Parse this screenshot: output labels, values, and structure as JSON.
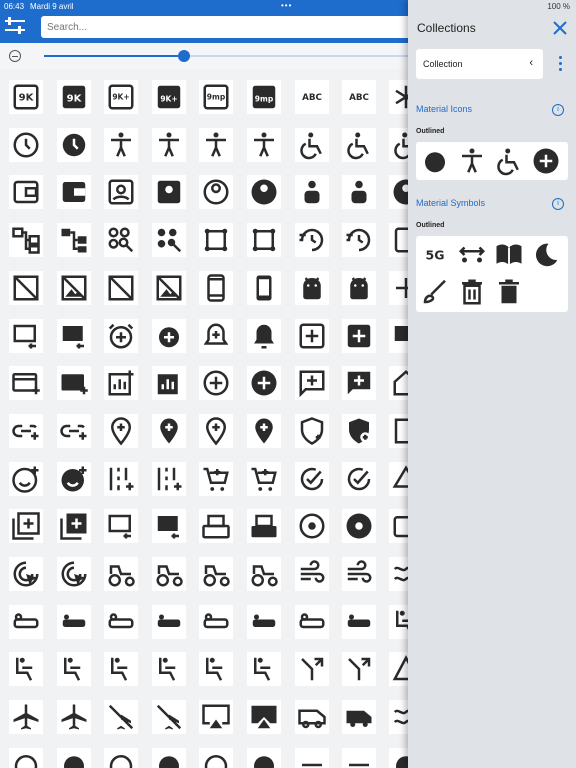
{
  "status": {
    "time": "06:43",
    "date": "Mardi 9 avril",
    "dots": "•••",
    "battery": "100 %"
  },
  "search": {
    "placeholder": "Search..."
  },
  "panel": {
    "title": "Collections",
    "collection_label": "Collection",
    "sections": [
      {
        "title": "Material Icons",
        "subtitle": "Outlined",
        "icons": [
          "alarm-icon",
          "accessibility-icon",
          "accessible-forward-icon",
          "add-circle-icon"
        ]
      },
      {
        "title": "Material Symbols",
        "subtitle": "Outlined",
        "icons": [
          "5g-icon",
          "social-distance-icon",
          "menu-book-icon",
          "dark-mode-icon",
          "brush-icon",
          "delete-outline-icon",
          "delete-icon"
        ]
      }
    ]
  },
  "grid_icons": [
    [
      "9k-outline-icon",
      "9k-icon",
      "9k-plus-outline-icon",
      "9k-plus-icon",
      "9mp-outline-icon",
      "9mp-icon",
      "abc-icon",
      "abc-icon",
      "asterisk-icon"
    ],
    [
      "access-time-icon",
      "access-time-filled-icon",
      "accessibility-icon",
      "accessibility-new-icon",
      "accessibility-icon",
      "accessibility-new-icon",
      "accessible-icon",
      "accessible-icon",
      "accessible-forward-icon"
    ],
    [
      "account-balance-wallet-outline-icon",
      "account-balance-wallet-icon",
      "account-box-outline-icon",
      "account-box-icon",
      "account-circle-outline-icon",
      "account-circle-icon",
      "account-id-icon",
      "account-id-icon",
      "account-circle-icon"
    ],
    [
      "account-tree-outline-icon",
      "account-tree-icon",
      "ad-units-outline-icon",
      "ad-units-icon",
      "adb-outline-icon",
      "adb-icon",
      "update-icon",
      "update-filled-icon",
      "tablet-icon"
    ],
    [
      "hide-image-outline-icon",
      "hide-image-icon",
      "image-not-supported-outline-icon",
      "image-not-supported-icon",
      "smartphone-outline-icon",
      "smartphone-icon",
      "android-outline-icon",
      "android-icon",
      "add-icon"
    ],
    [
      "add-to-queue-outline-icon",
      "add-to-queue-icon",
      "add-alarm-outline-icon",
      "add-alarm-icon",
      "notification-add-outline-icon",
      "notification-add-icon",
      "add-box-outline-icon",
      "add-box-icon",
      "queue-icon"
    ],
    [
      "add-card-outline-icon",
      "add-card-icon",
      "addchart-outline-icon",
      "addchart-icon",
      "add-circle-outline-icon",
      "add-circle-icon",
      "add-comment-outline-icon",
      "add-comment-icon",
      "add-home-icon"
    ],
    [
      "add-link-icon",
      "add-link-icon",
      "add-location-outline-icon",
      "add-location-icon",
      "add-location-alt-outline-icon",
      "add-location-alt-icon",
      "add-moderator-outline-icon",
      "add-moderator-icon",
      "add-notes-icon"
    ],
    [
      "add-reaction-outline-icon",
      "add-reaction-icon",
      "add-road-icon",
      "add-road-icon",
      "add-shopping-cart-icon",
      "add-shopping-cart-icon",
      "add-task-icon",
      "add-task-icon",
      "add-to-drive-icon"
    ],
    [
      "library-add-outline-icon",
      "library-add-icon",
      "add-to-queue-outline-icon",
      "add-to-queue-icon",
      "adf-scanner-outline-icon",
      "adf-scanner-icon",
      "adjust-icon",
      "adjust-filled-icon",
      "add-photo-icon"
    ],
    [
      "ads-click-icon",
      "ads-click-icon",
      "agriculture-icon",
      "agriculture-icon",
      "agriculture-outline-icon",
      "agriculture-icon",
      "air-icon",
      "air-icon",
      "airline-icon"
    ],
    [
      "airline-seat-flat-outline-icon",
      "airline-seat-flat-icon",
      "airline-seat-flat-angled-outline-icon",
      "airline-seat-flat-angled-icon",
      "airline-seat-individual-suite-outline-icon",
      "airline-seat-individual-suite-icon",
      "airline-seat-legroom-extra-outline-icon",
      "airline-seat-legroom-extra-icon",
      "airline-seat-icon"
    ],
    [
      "airline-seat-recline-extra-icon",
      "airline-seat-recline-extra-icon",
      "airline-seat-recline-normal-icon",
      "airline-seat-recline-normal-icon",
      "airline-seat-legroom-normal-icon",
      "airline-seat-legroom-normal-icon",
      "alt-route-icon",
      "alt-route-icon",
      "change-history-icon"
    ],
    [
      "airplanemode-active-icon",
      "airplanemode-active-icon",
      "airplanemode-inactive-icon",
      "airplanemode-inactive-icon",
      "airplay-outline-icon",
      "airplay-icon",
      "airport-shuttle-outline-icon",
      "airport-shuttle-icon",
      "air-waves-icon"
    ],
    [
      "alarm-on-outline-icon",
      "alarm-on-icon",
      "alarm-snooze-outline-icon",
      "alarm-snooze-icon",
      "album-outline-icon",
      "album-icon",
      "horizontal-rule-icon",
      "horizontal-rule-icon",
      "alarm-icon"
    ]
  ],
  "colors": {
    "accent": "#1e6ccc",
    "panel": "#dfe2e6",
    "icon": "#2b2b2b"
  }
}
